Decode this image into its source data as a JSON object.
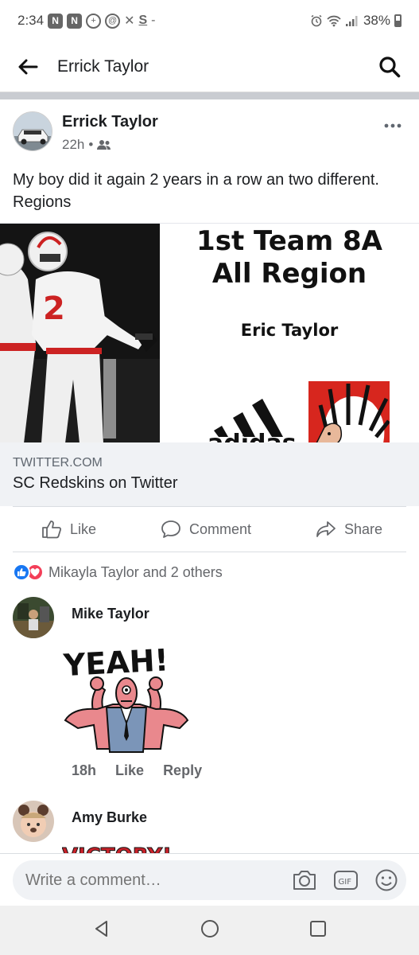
{
  "status_bar": {
    "time": "2:34",
    "battery": "38%",
    "dash": "-"
  },
  "header": {
    "title": "Errick Taylor"
  },
  "post": {
    "author": "Errick Taylor",
    "time": "22h",
    "dot": "•",
    "text": "My boy did it again 2 years in a row an two different. Regions",
    "link": {
      "graphic_title_line1": "1st Team 8A",
      "graphic_title_line2": "All Region",
      "graphic_name": "Eric Taylor",
      "brand": "adidas",
      "jersey_number": "2",
      "domain": "TWITTER.COM",
      "title": "SC Redskins on Twitter"
    }
  },
  "actions": {
    "like": "Like",
    "comment": "Comment",
    "share": "Share"
  },
  "reactions": {
    "summary": "Mikayla Taylor and 2 others"
  },
  "comments": [
    {
      "author": "Mike Taylor",
      "sticker_text": "YEAH!",
      "time": "18h",
      "like": "Like",
      "reply": "Reply"
    },
    {
      "author": "Amy Burke",
      "sticker_text": "VICTORY!"
    }
  ],
  "composer": {
    "placeholder": "Write a comment…",
    "gif": "GIF"
  },
  "colors": {
    "accent": "#1877f2",
    "love": "#f33e58",
    "text_secondary": "#65676b"
  }
}
